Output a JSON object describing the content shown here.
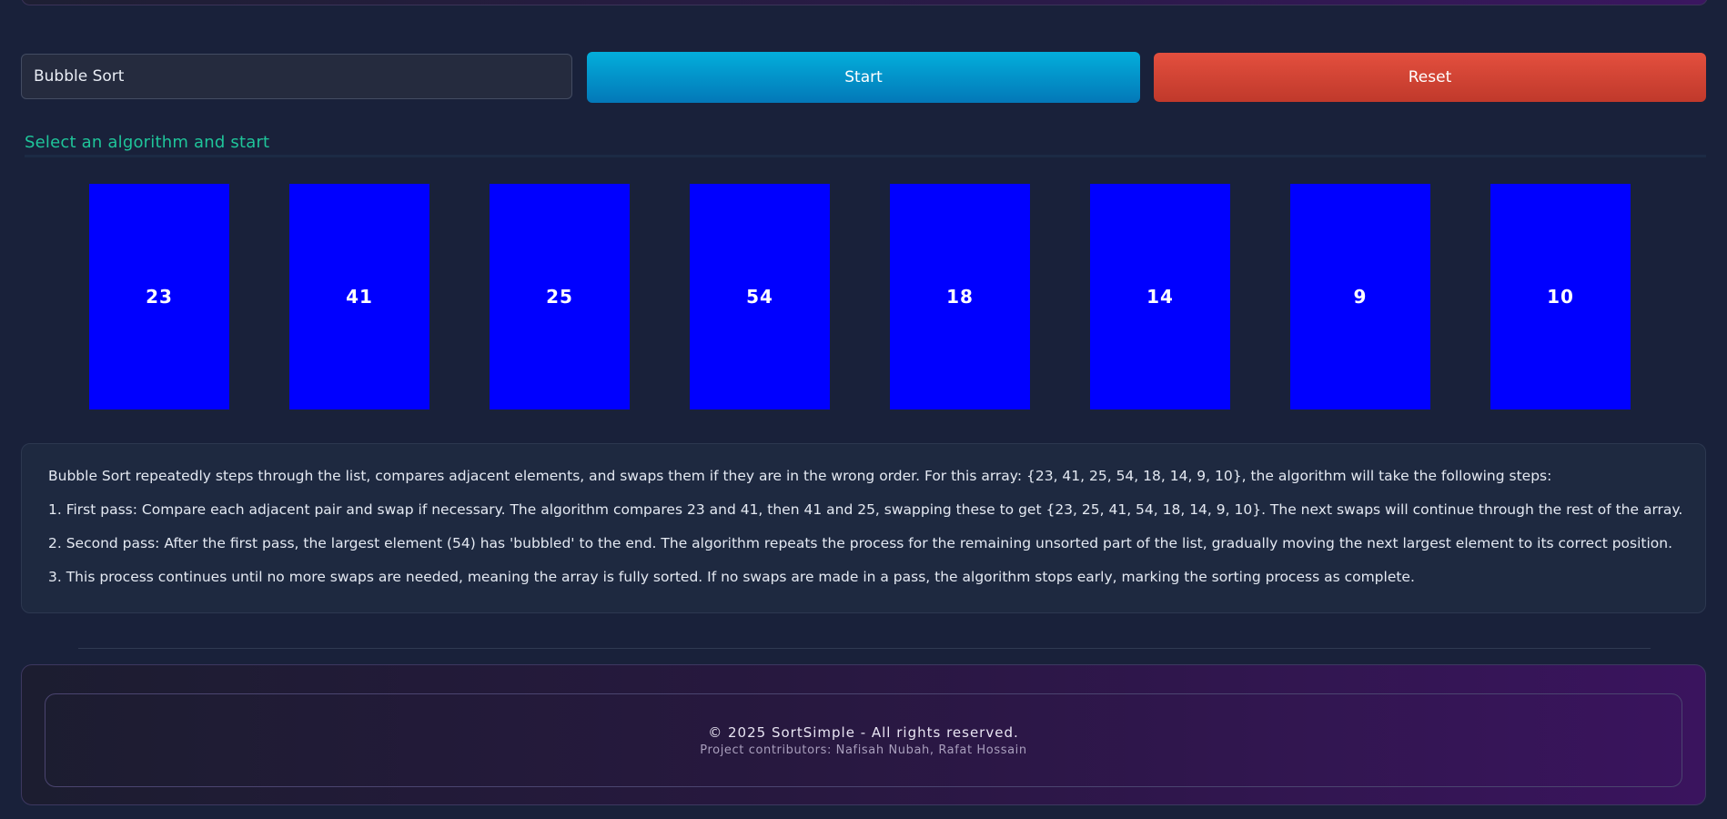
{
  "controls": {
    "algorithm_value": "Bubble Sort",
    "start_label": "Start",
    "reset_label": "Reset"
  },
  "status_text": "Select an algorithm and start",
  "array": [
    "23",
    "41",
    "25",
    "54",
    "18",
    "14",
    "9",
    "10"
  ],
  "explanation": [
    "Bubble Sort repeatedly steps through the list, compares adjacent elements, and swaps them if they are in the wrong order. For this array: {23, 41, 25, 54, 18, 14, 9, 10}, the algorithm will take the following steps:",
    "1. First pass: Compare each adjacent pair and swap if necessary. The algorithm compares 23 and 41, then 41 and 25, swapping these to get {23, 25, 41, 54, 18, 14, 9, 10}. The next swaps will continue through the rest of the array.",
    "2. Second pass: After the first pass, the largest element (54) has 'bubbled' to the end. The algorithm repeats the process for the remaining unsorted part of the list, gradually moving the next largest element to its correct position.",
    "3. This process continues until no more swaps are needed, meaning the array is fully sorted. If no swaps are made in a pass, the algorithm stops early, marking the sorting process as complete."
  ],
  "footer": {
    "copyright": "© 2025 SortSimple - All rights reserved.",
    "contributors": "Project contributors: Nafisah Nubah, Rafat Hossain"
  },
  "colors": {
    "bar": "#0000ff",
    "start_button": "#0396cc",
    "reset_button": "#d84435",
    "status_text": "#1fc59a"
  }
}
